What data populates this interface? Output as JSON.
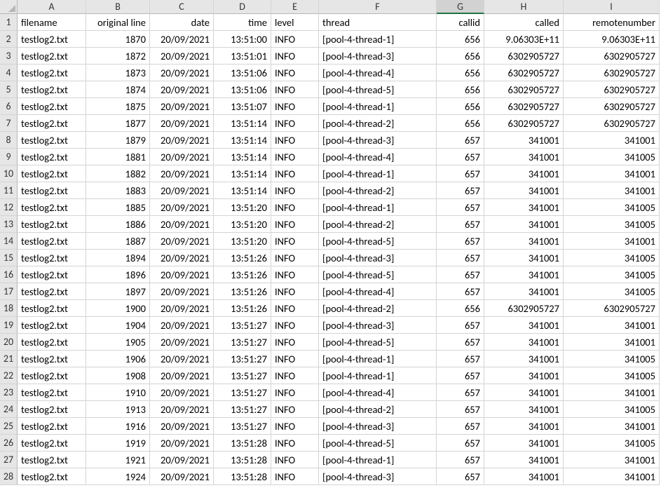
{
  "chart_data": {
    "type": "table",
    "columns": [
      "filename",
      "original line",
      "date",
      "time",
      "level",
      "thread",
      "callid",
      "called",
      "remotenumber"
    ],
    "rows": [
      [
        "testlog2.txt",
        1870,
        "20/09/2021",
        "13:51:00",
        "INFO",
        "[pool-4-thread-1]",
        656,
        "9.06303E+11",
        "9.06303E+11"
      ],
      [
        "testlog2.txt",
        1872,
        "20/09/2021",
        "13:51:01",
        "INFO",
        "[pool-4-thread-3]",
        656,
        "6302905727",
        "6302905727"
      ],
      [
        "testlog2.txt",
        1873,
        "20/09/2021",
        "13:51:06",
        "INFO",
        "[pool-4-thread-4]",
        656,
        "6302905727",
        "6302905727"
      ],
      [
        "testlog2.txt",
        1874,
        "20/09/2021",
        "13:51:06",
        "INFO",
        "[pool-4-thread-5]",
        656,
        "6302905727",
        "6302905727"
      ],
      [
        "testlog2.txt",
        1875,
        "20/09/2021",
        "13:51:07",
        "INFO",
        "[pool-4-thread-1]",
        656,
        "6302905727",
        "6302905727"
      ],
      [
        "testlog2.txt",
        1877,
        "20/09/2021",
        "13:51:14",
        "INFO",
        "[pool-4-thread-2]",
        656,
        "6302905727",
        "6302905727"
      ],
      [
        "testlog2.txt",
        1879,
        "20/09/2021",
        "13:51:14",
        "INFO",
        "[pool-4-thread-3]",
        657,
        "341001",
        "341001"
      ],
      [
        "testlog2.txt",
        1881,
        "20/09/2021",
        "13:51:14",
        "INFO",
        "[pool-4-thread-4]",
        657,
        "341001",
        "341005"
      ],
      [
        "testlog2.txt",
        1882,
        "20/09/2021",
        "13:51:14",
        "INFO",
        "[pool-4-thread-1]",
        657,
        "341001",
        "341001"
      ],
      [
        "testlog2.txt",
        1883,
        "20/09/2021",
        "13:51:14",
        "INFO",
        "[pool-4-thread-2]",
        657,
        "341001",
        "341001"
      ],
      [
        "testlog2.txt",
        1885,
        "20/09/2021",
        "13:51:20",
        "INFO",
        "[pool-4-thread-1]",
        657,
        "341001",
        "341005"
      ],
      [
        "testlog2.txt",
        1886,
        "20/09/2021",
        "13:51:20",
        "INFO",
        "[pool-4-thread-2]",
        657,
        "341001",
        "341005"
      ],
      [
        "testlog2.txt",
        1887,
        "20/09/2021",
        "13:51:20",
        "INFO",
        "[pool-4-thread-5]",
        657,
        "341001",
        "341001"
      ],
      [
        "testlog2.txt",
        1894,
        "20/09/2021",
        "13:51:26",
        "INFO",
        "[pool-4-thread-3]",
        657,
        "341001",
        "341005"
      ],
      [
        "testlog2.txt",
        1896,
        "20/09/2021",
        "13:51:26",
        "INFO",
        "[pool-4-thread-5]",
        657,
        "341001",
        "341005"
      ],
      [
        "testlog2.txt",
        1897,
        "20/09/2021",
        "13:51:26",
        "INFO",
        "[pool-4-thread-4]",
        657,
        "341001",
        "341005"
      ],
      [
        "testlog2.txt",
        1900,
        "20/09/2021",
        "13:51:26",
        "INFO",
        "[pool-4-thread-2]",
        656,
        "6302905727",
        "6302905727"
      ],
      [
        "testlog2.txt",
        1904,
        "20/09/2021",
        "13:51:27",
        "INFO",
        "[pool-4-thread-3]",
        657,
        "341001",
        "341001"
      ],
      [
        "testlog2.txt",
        1905,
        "20/09/2021",
        "13:51:27",
        "INFO",
        "[pool-4-thread-5]",
        657,
        "341001",
        "341001"
      ],
      [
        "testlog2.txt",
        1906,
        "20/09/2021",
        "13:51:27",
        "INFO",
        "[pool-4-thread-1]",
        657,
        "341001",
        "341005"
      ],
      [
        "testlog2.txt",
        1908,
        "20/09/2021",
        "13:51:27",
        "INFO",
        "[pool-4-thread-1]",
        657,
        "341001",
        "341005"
      ],
      [
        "testlog2.txt",
        1910,
        "20/09/2021",
        "13:51:27",
        "INFO",
        "[pool-4-thread-4]",
        657,
        "341001",
        "341001"
      ],
      [
        "testlog2.txt",
        1913,
        "20/09/2021",
        "13:51:27",
        "INFO",
        "[pool-4-thread-2]",
        657,
        "341001",
        "341005"
      ],
      [
        "testlog2.txt",
        1916,
        "20/09/2021",
        "13:51:27",
        "INFO",
        "[pool-4-thread-3]",
        657,
        "341001",
        "341001"
      ],
      [
        "testlog2.txt",
        1919,
        "20/09/2021",
        "13:51:28",
        "INFO",
        "[pool-4-thread-5]",
        657,
        "341001",
        "341005"
      ],
      [
        "testlog2.txt",
        1921,
        "20/09/2021",
        "13:51:28",
        "INFO",
        "[pool-4-thread-1]",
        657,
        "341001",
        "341001"
      ],
      [
        "testlog2.txt",
        1924,
        "20/09/2021",
        "13:51:28",
        "INFO",
        "[pool-4-thread-3]",
        657,
        "341001",
        "341001"
      ]
    ]
  },
  "cols": [
    "A",
    "B",
    "C",
    "D",
    "E",
    "F",
    "G",
    "H",
    "I"
  ],
  "selected_col": "G",
  "row_count": 28,
  "align": [
    "l",
    "r",
    "r",
    "r",
    "l",
    "l",
    "r",
    "r",
    "r"
  ]
}
